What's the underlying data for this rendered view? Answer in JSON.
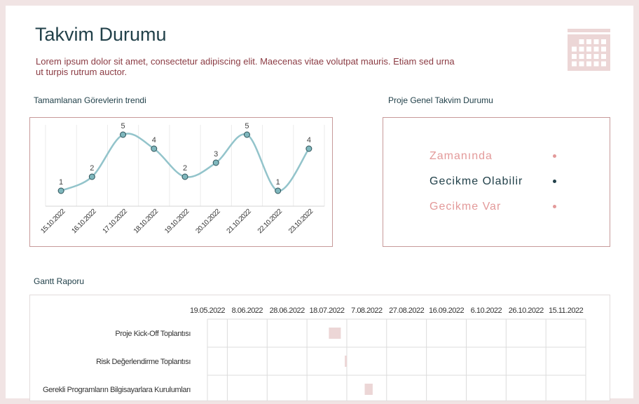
{
  "header": {
    "title": "Takvim Durumu",
    "subtitle": "Lorem ipsum dolor sit amet, consectetur adipiscing elit. Maecenas vitae volutpat mauris. Etiam sed urna ut turpis rutrum auctor."
  },
  "icons": {
    "calendar": "calendar-icon"
  },
  "sections": {
    "trend_label": "Tamamlanan Görevlerin trendi",
    "status_label": "Proje Genel Takvim Durumu",
    "gantt_label": "Gantt Raporu"
  },
  "status_legend": [
    {
      "label": "Zamanında",
      "color": "#e39a9a"
    },
    {
      "label": "Gecikme Olabilir",
      "color": "#22414a"
    },
    {
      "label": "Gecikme Var",
      "color": "#e39a9a"
    }
  ],
  "colors": {
    "line": "#93c4cb",
    "marker_fill": "#7fb7bd",
    "marker_stroke": "#2e5258",
    "gantt_bar": "#ecd6d6",
    "text_dark": "#22414a",
    "text_red": "#8b3b43"
  },
  "chart_data": [
    {
      "type": "line",
      "categories": [
        "15.10.2022",
        "16.10.2022",
        "17.10.2022",
        "18.10.2022",
        "19.10.2022",
        "20.10.2022",
        "21.10.2022",
        "22.10.2022",
        "23.10.2022"
      ],
      "values": [
        1,
        2,
        5,
        4,
        2,
        3,
        5,
        1,
        4
      ],
      "title": "Tamamlanan Görevlerin trendi",
      "data_labels": true,
      "smooth": true,
      "grid": "vertical"
    },
    {
      "type": "bar",
      "orientation": "horizontal-gantt",
      "title": "Gantt Raporu",
      "x_ticks": [
        "19.05.2022",
        "8.06.2022",
        "28.06.2022",
        "18.07.2022",
        "7.08.2022",
        "27.08.2022",
        "16.09.2022",
        "6.10.2022",
        "26.10.2022",
        "15.11.2022"
      ],
      "x_range": [
        "19.05.2022",
        "25.11.2022"
      ],
      "tasks": [
        {
          "name": "Proje Kick-Off Toplantısı",
          "start": "19.07.2022",
          "end": "25.07.2022"
        },
        {
          "name": "Risk Değerlendirme Toplantısı",
          "start": "27.07.2022",
          "end": "28.07.2022"
        },
        {
          "name": "Gerekli Programların Bilgisayarlara Kurulumları",
          "start": "06.08.2022",
          "end": "10.08.2022"
        }
      ]
    }
  ]
}
